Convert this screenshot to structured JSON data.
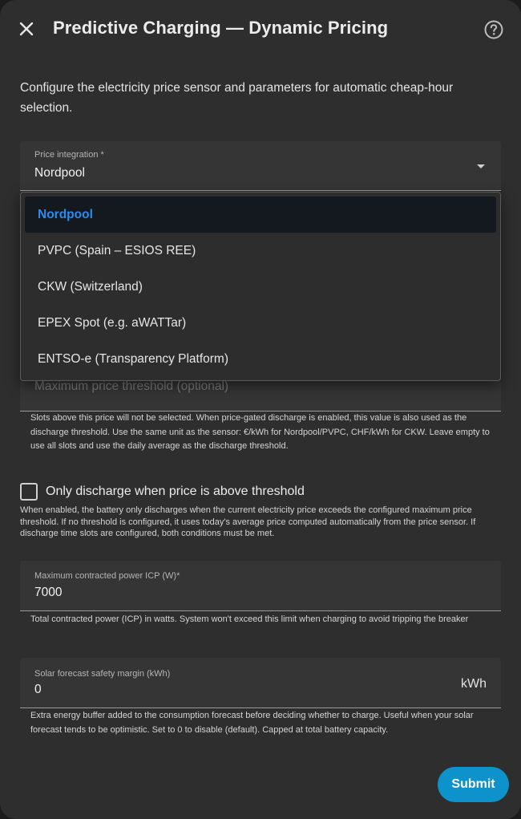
{
  "dialog": {
    "title": "Predictive Charging — Dynamic Pricing",
    "description": "Configure the electricity price sensor and parameters for automatic cheap-hour selection."
  },
  "price_integration": {
    "label": "Price integration *",
    "value": "Nordpool",
    "options": [
      {
        "label": "Nordpool",
        "selected": true
      },
      {
        "label": "PVPC (Spain – ESIOS REE)",
        "selected": false
      },
      {
        "label": "CKW (Switzerland)",
        "selected": false
      },
      {
        "label": "EPEX Spot (e.g. aWATTar)",
        "selected": false
      },
      {
        "label": "ENTSO-e (Transparency Platform)",
        "selected": false
      }
    ]
  },
  "max_price": {
    "placeholder": "Maximum price threshold (optional)",
    "helper": "Slots above this price will not be selected. When price-gated discharge is enabled, this value is also used as the discharge threshold. Use the same unit as the sensor: €/kWh for Nordpool/PVPC, CHF/kWh for CKW. Leave empty to use all slots and use the daily average as the discharge threshold."
  },
  "discharge_checkbox": {
    "label": "Only discharge when price is above threshold",
    "checked": false,
    "helper": "When enabled, the battery only discharges when the current electricity price exceeds the configured maximum price threshold. If no threshold is configured, it uses today's average price computed automatically from the price sensor. If discharge time slots are configured, both conditions must be met."
  },
  "icp": {
    "label": "Maximum contracted power ICP (W)*",
    "value": "7000",
    "helper": "Total contracted power (ICP) in watts. System won't exceed this limit when charging to avoid tripping the breaker"
  },
  "solar_margin": {
    "label": "Solar forecast safety margin (kWh)",
    "value": "0",
    "unit": "kWh",
    "helper": "Extra energy buffer added to the consumption forecast before deciding whether to charge. Useful when your solar forecast tends to be optimistic. Set to 0 to disable (default). Capped at total battery capacity."
  },
  "actions": {
    "submit": "Submit"
  },
  "colors": {
    "accent": "#0d92cb",
    "selected_text": "#2c8bf0",
    "background": "#2e2e2e"
  }
}
